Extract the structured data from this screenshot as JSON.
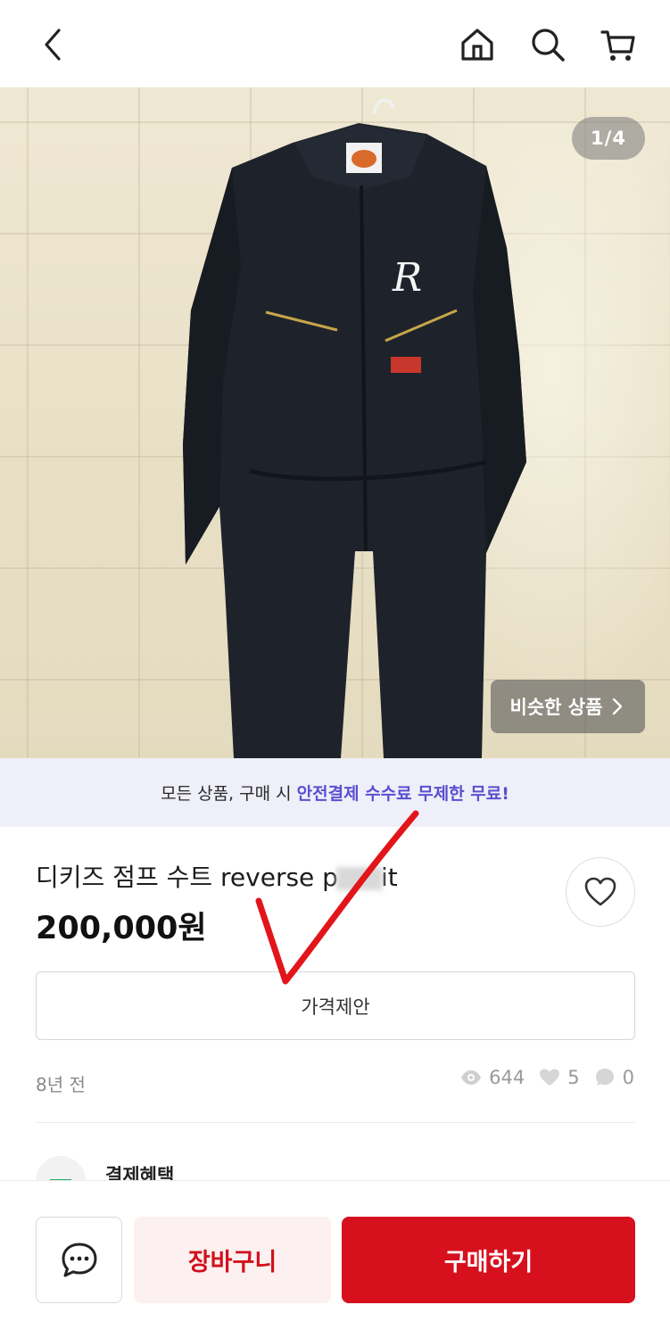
{
  "header": {
    "icons": [
      "back-icon",
      "home-icon",
      "search-icon",
      "cart-icon"
    ]
  },
  "gallery": {
    "counter": "1/4",
    "similar_label": "비슷한 상품"
  },
  "promo": {
    "text": "모든 상품, 구매 시",
    "highlight": "안전결제 수수료 무제한 무료!",
    "highlight_color": "#5a4fcf"
  },
  "product": {
    "title_start": "디키즈 점프 수트 reverse p",
    "title_end": "it",
    "price": "200,000원",
    "offer_label": "가격제안",
    "posted": "8년 전",
    "views": "644",
    "likes": "5",
    "comments": "0"
  },
  "benefit": {
    "label": "결제혜택"
  },
  "actions": {
    "cart_label": "장바구니",
    "buy_label": "구매하기",
    "buy_color": "#d7101d"
  }
}
